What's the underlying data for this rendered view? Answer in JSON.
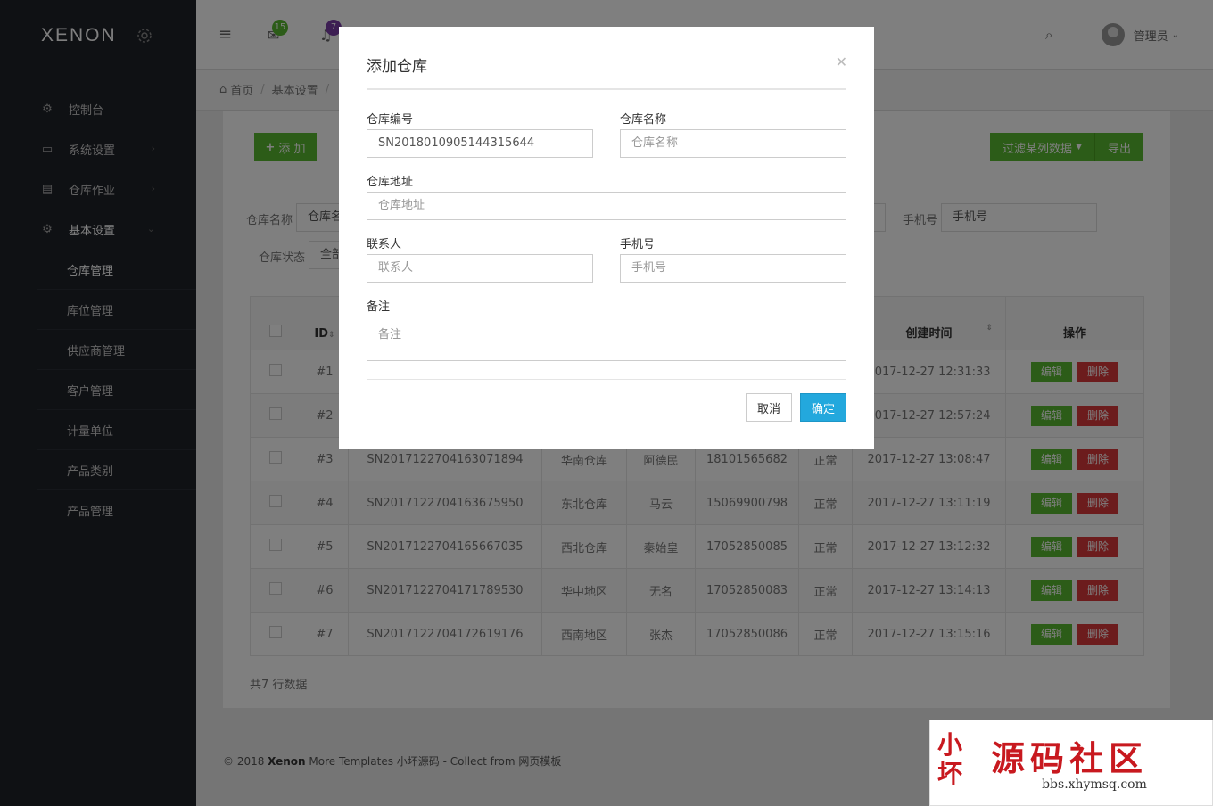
{
  "brand": "XENON",
  "sidebar": {
    "items": [
      {
        "label": "控制台",
        "icon": "dashboard-icon"
      },
      {
        "label": "系统设置",
        "icon": "monitor-icon"
      },
      {
        "label": "仓库作业",
        "icon": "warehouse-icon"
      },
      {
        "label": "基本设置",
        "icon": "gear-icon"
      }
    ],
    "subitems": [
      "仓库管理",
      "库位管理",
      "供应商管理",
      "客户管理",
      "计量单位",
      "产品类别",
      "产品管理"
    ]
  },
  "topbar": {
    "mail_count": "15",
    "notify_count": "7",
    "user_name": "管理员"
  },
  "breadcrumb": [
    "首页",
    "基本设置"
  ],
  "toolbar": {
    "add_label": "添 加",
    "filter_label": "过滤某列数据",
    "export_label": "导出"
  },
  "filters": {
    "name_label": "仓库名称",
    "name_value": "仓库名",
    "phone_label": "手机号",
    "phone_placeholder": "手机号",
    "status_label": "仓库状态",
    "status_value": "全部"
  },
  "table": {
    "headers": {
      "id": "ID",
      "created": "创建时间",
      "ops": "操作"
    },
    "edit_label": "编辑",
    "delete_label": "删除",
    "rows": [
      {
        "id": "#1",
        "sn": "",
        "name": "",
        "contact": "",
        "phone": "",
        "status": "",
        "created": "2017-12-27 12:31:33"
      },
      {
        "id": "#2",
        "sn": "",
        "name": "",
        "contact": "",
        "phone": "",
        "status": "",
        "created": "2017-12-27 12:57:24"
      },
      {
        "id": "#3",
        "sn": "SN2017122704163071894",
        "name": "华南仓库",
        "contact": "阿德民",
        "phone": "18101565682",
        "status": "正常",
        "created": "2017-12-27 13:08:47"
      },
      {
        "id": "#4",
        "sn": "SN2017122704163675950",
        "name": "东北仓库",
        "contact": "马云",
        "phone": "15069900798",
        "status": "正常",
        "created": "2017-12-27 13:11:19"
      },
      {
        "id": "#5",
        "sn": "SN2017122704165667035",
        "name": "西北仓库",
        "contact": "秦始皇",
        "phone": "17052850085",
        "status": "正常",
        "created": "2017-12-27 13:12:32"
      },
      {
        "id": "#6",
        "sn": "SN2017122704171789530",
        "name": "华中地区",
        "contact": "无名",
        "phone": "17052850083",
        "status": "正常",
        "created": "2017-12-27 13:14:13"
      },
      {
        "id": "#7",
        "sn": "SN2017122704172619176",
        "name": "西南地区",
        "contact": "张杰",
        "phone": "17052850086",
        "status": "正常",
        "created": "2017-12-27 13:15:16"
      }
    ],
    "footer": "共7 行数据"
  },
  "footer": {
    "prefix": "© 2018 ",
    "brand": "Xenon",
    "suffix": " More Templates 小坏源码 - Collect from 网页模板"
  },
  "modal": {
    "title": "添加仓库",
    "sn_label": "仓库编号",
    "sn_value": "SN2018010905144315644",
    "name_label": "仓库名称",
    "name_placeholder": "仓库名称",
    "addr_label": "仓库地址",
    "addr_placeholder": "仓库地址",
    "contact_label": "联系人",
    "contact_placeholder": "联系人",
    "phone_label": "手机号",
    "phone_placeholder": "手机号",
    "note_label": "备注",
    "note_placeholder": "备注",
    "cancel_label": "取消",
    "ok_label": "确定"
  },
  "watermark": {
    "logo": "小坏",
    "title": "源码社区",
    "url": "bbs.xhymsq.com"
  },
  "colors": {
    "primary": "#58b830",
    "danger": "#d9383b",
    "info": "#23a8dd",
    "sidebar": "#1f2229"
  }
}
